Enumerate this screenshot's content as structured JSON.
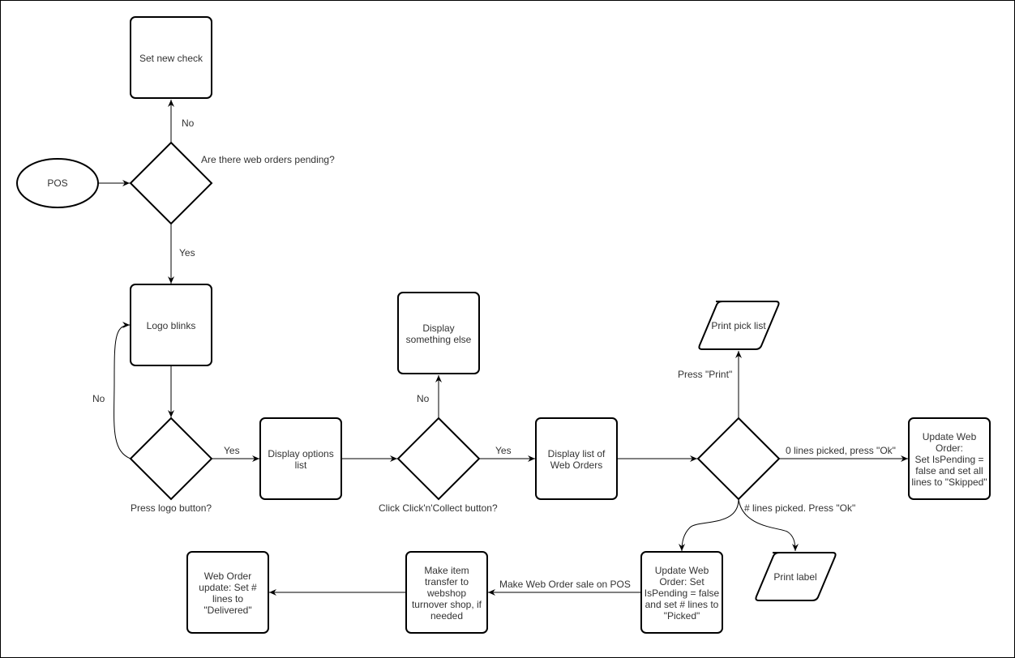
{
  "diagram": {
    "type": "flowchart",
    "nodes": {
      "pos": {
        "label": [
          "POS"
        ],
        "shape": "ellipse"
      },
      "web_orders_pending": {
        "label": [],
        "shape": "diamond",
        "caption": "Are there web orders pending?"
      },
      "set_new_check": {
        "label": [
          "Set new check"
        ],
        "shape": "rounded-rect"
      },
      "logo_blinks": {
        "label": [
          "Logo blinks"
        ],
        "shape": "rounded-rect"
      },
      "press_logo": {
        "label": [],
        "shape": "diamond",
        "caption": "Press logo button?"
      },
      "display_options": {
        "label": [
          "Display options",
          "list"
        ],
        "shape": "rounded-rect"
      },
      "click_collect": {
        "label": [],
        "shape": "diamond",
        "caption": "Click Click'n'Collect button?"
      },
      "display_else": {
        "label": [
          "Display",
          "something else"
        ],
        "shape": "rounded-rect"
      },
      "display_web_orders": {
        "label": [
          "Display list of",
          "Web Orders"
        ],
        "shape": "rounded-rect"
      },
      "pick_decision": {
        "label": [],
        "shape": "diamond"
      },
      "print_pick_list": {
        "label": [
          "Print pick list"
        ],
        "shape": "parallelogram"
      },
      "update_skipped": {
        "label": [
          "Update Web",
          "Order:",
          "Set IsPending =",
          "false and set all",
          "lines to \"Skipped\""
        ],
        "shape": "rounded-rect"
      },
      "update_picked": {
        "label": [
          "Update Web",
          "Order: Set",
          "IsPending = false",
          "and set # lines to",
          "\"Picked\""
        ],
        "shape": "rounded-rect"
      },
      "print_label": {
        "label": [
          "Print label"
        ],
        "shape": "parallelogram"
      },
      "item_transfer": {
        "label": [
          "Make item",
          "transfer to",
          "webshop",
          "turnover shop, if",
          "needed"
        ],
        "shape": "rounded-rect"
      },
      "delivered": {
        "label": [
          "Web Order",
          "update: Set #",
          "lines to",
          "\"Delivered\""
        ],
        "shape": "rounded-rect"
      }
    },
    "edges": [
      {
        "from": "pos",
        "to": "web_orders_pending",
        "label": ""
      },
      {
        "from": "web_orders_pending",
        "to": "set_new_check",
        "label": "No"
      },
      {
        "from": "web_orders_pending",
        "to": "logo_blinks",
        "label": "Yes"
      },
      {
        "from": "logo_blinks",
        "to": "press_logo",
        "label": ""
      },
      {
        "from": "press_logo",
        "to": "logo_blinks",
        "label": "No"
      },
      {
        "from": "press_logo",
        "to": "display_options",
        "label": "Yes"
      },
      {
        "from": "display_options",
        "to": "click_collect",
        "label": ""
      },
      {
        "from": "click_collect",
        "to": "display_else",
        "label": "No"
      },
      {
        "from": "click_collect",
        "to": "display_web_orders",
        "label": "Yes"
      },
      {
        "from": "display_web_orders",
        "to": "pick_decision",
        "label": ""
      },
      {
        "from": "pick_decision",
        "to": "print_pick_list",
        "label": "Press \"Print\""
      },
      {
        "from": "pick_decision",
        "to": "update_skipped",
        "label": "0 lines picked, press \"Ok\""
      },
      {
        "from": "pick_decision",
        "to": "update_picked",
        "label": "# lines picked. Press \"Ok\""
      },
      {
        "from": "pick_decision",
        "to": "print_label",
        "label": ""
      },
      {
        "from": "update_picked",
        "to": "item_transfer",
        "label": "Make Web Order sale on POS"
      },
      {
        "from": "item_transfer",
        "to": "delivered",
        "label": ""
      }
    ]
  }
}
